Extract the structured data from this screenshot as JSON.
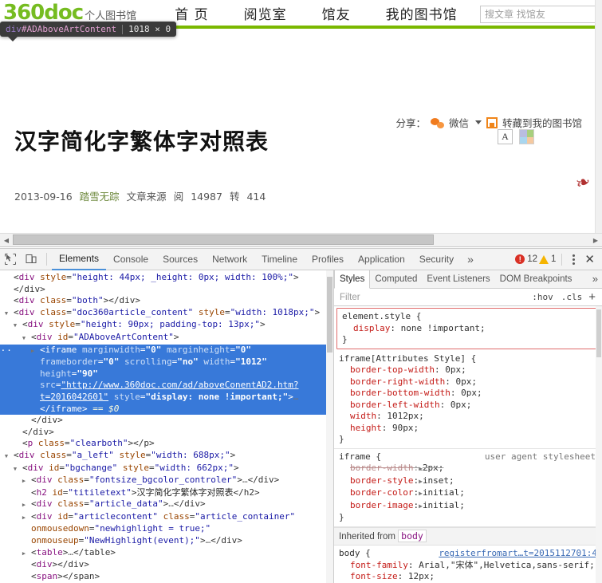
{
  "site": {
    "logo_main": "360doc",
    "logo_sub": "个人图书馆",
    "nav": [
      {
        "label": "首 页"
      },
      {
        "label": "阅览室"
      },
      {
        "label": "馆友"
      },
      {
        "label": "我的图书馆"
      }
    ],
    "search_placeholder": "搜文章 找馆友",
    "search_value": ""
  },
  "inspect_tooltip": {
    "tag": "div",
    "id": "#ADAboveArtContent",
    "dimensions": "1018 × 0"
  },
  "article": {
    "title": "汉字简化字繁体字对照表",
    "date": "2013-09-16",
    "author": "踏雪无踪",
    "source": "文章来源",
    "read_label": "阅",
    "read_count": "14987",
    "forward_label": "转",
    "forward_count": "414",
    "font_btn": "A",
    "share_label": "分享：",
    "wechat_label": "微信",
    "save_label": "转藏到我的图书馆"
  },
  "devtools": {
    "tabs": [
      {
        "label": "Elements",
        "active": true
      },
      {
        "label": "Console",
        "active": false
      },
      {
        "label": "Sources",
        "active": false
      },
      {
        "label": "Network",
        "active": false
      },
      {
        "label": "Timeline",
        "active": false
      },
      {
        "label": "Profiles",
        "active": false
      },
      {
        "label": "Application",
        "active": false
      },
      {
        "label": "Security",
        "active": false
      }
    ],
    "more": "»",
    "error_count": "12",
    "warning_count": "1",
    "close": "✕"
  },
  "dom": {
    "lines": [
      {
        "indent": 1,
        "twisty": "none",
        "parts": [
          {
            "t": "punc",
            "v": "<"
          },
          {
            "t": "tag",
            "v": "div"
          },
          {
            "t": "sp",
            "v": " "
          },
          {
            "t": "attr",
            "v": "style"
          },
          {
            "t": "punc",
            "v": "="
          },
          {
            "t": "val",
            "v": "\"height: 44px; _height: 0px; width: 100%;\""
          },
          {
            "t": "punc",
            "v": "></div>"
          }
        ]
      },
      {
        "indent": 1,
        "twisty": "none",
        "parts": [
          {
            "t": "punc",
            "v": "<"
          },
          {
            "t": "tag",
            "v": "div"
          },
          {
            "t": "sp",
            "v": " "
          },
          {
            "t": "attr",
            "v": "class"
          },
          {
            "t": "punc",
            "v": "="
          },
          {
            "t": "val",
            "v": "\"both\""
          },
          {
            "t": "punc",
            "v": "></div>"
          }
        ]
      },
      {
        "indent": 1,
        "twisty": "open",
        "parts": [
          {
            "t": "punc",
            "v": "<"
          },
          {
            "t": "tag",
            "v": "div"
          },
          {
            "t": "sp",
            "v": " "
          },
          {
            "t": "attr",
            "v": "class"
          },
          {
            "t": "punc",
            "v": "="
          },
          {
            "t": "val",
            "v": "\"doc360article_content\""
          },
          {
            "t": "sp",
            "v": " "
          },
          {
            "t": "attr",
            "v": "style"
          },
          {
            "t": "punc",
            "v": "="
          },
          {
            "t": "val",
            "v": "\"width: 1018px;\""
          },
          {
            "t": "punc",
            "v": ">"
          }
        ]
      },
      {
        "indent": 2,
        "twisty": "open",
        "parts": [
          {
            "t": "punc",
            "v": "<"
          },
          {
            "t": "tag",
            "v": "div"
          },
          {
            "t": "sp",
            "v": " "
          },
          {
            "t": "attr",
            "v": "style"
          },
          {
            "t": "punc",
            "v": "="
          },
          {
            "t": "val",
            "v": "\"height: 90px; padding-top: 13px;\""
          },
          {
            "t": "punc",
            "v": ">"
          }
        ]
      },
      {
        "indent": 3,
        "twisty": "open",
        "parts": [
          {
            "t": "punc",
            "v": "<"
          },
          {
            "t": "tag",
            "v": "div"
          },
          {
            "t": "sp",
            "v": " "
          },
          {
            "t": "attr",
            "v": "id"
          },
          {
            "t": "punc",
            "v": "="
          },
          {
            "t": "val",
            "v": "\"ADAboveArtContent\""
          },
          {
            "t": "punc",
            "v": ">"
          }
        ]
      },
      {
        "indent": 4,
        "twisty": "closed",
        "selected": true,
        "parts": [
          {
            "t": "punc",
            "v": "<"
          },
          {
            "t": "tag",
            "v": "iframe"
          },
          {
            "t": "sp",
            "v": " "
          },
          {
            "t": "attr",
            "v": "marginwidth"
          },
          {
            "t": "punc",
            "v": "="
          },
          {
            "t": "val",
            "v": "\"0\""
          },
          {
            "t": "sp",
            "v": " "
          },
          {
            "t": "attr",
            "v": "marginheight"
          },
          {
            "t": "punc",
            "v": "="
          },
          {
            "t": "val",
            "v": "\"0\""
          },
          {
            "t": "sp",
            "v": " "
          },
          {
            "t": "attr",
            "v": "frameborder"
          },
          {
            "t": "punc",
            "v": "="
          },
          {
            "t": "val",
            "v": "\"0\""
          },
          {
            "t": "sp",
            "v": " "
          },
          {
            "t": "attr",
            "v": "scrolling"
          },
          {
            "t": "punc",
            "v": "="
          },
          {
            "t": "val",
            "v": "\"no\""
          },
          {
            "t": "sp",
            "v": " "
          },
          {
            "t": "attr",
            "v": "width"
          },
          {
            "t": "punc",
            "v": "="
          },
          {
            "t": "val",
            "v": "\"1012\""
          },
          {
            "t": "sp",
            "v": " "
          },
          {
            "t": "attr",
            "v": "height"
          },
          {
            "t": "punc",
            "v": "="
          },
          {
            "t": "val",
            "v": "\"90\""
          },
          {
            "t": "sp",
            "v": " "
          },
          {
            "t": "attr",
            "v": "src"
          },
          {
            "t": "punc",
            "v": "="
          },
          {
            "t": "lnk",
            "v": "\"http://www.360doc.com/ad/aboveConentAD2.htm?t=2016042601\""
          },
          {
            "t": "sp",
            "v": " "
          },
          {
            "t": "attr",
            "v": "style"
          },
          {
            "t": "punc",
            "v": "="
          },
          {
            "t": "val",
            "v": "\"display: none !important;\""
          },
          {
            "t": "punc",
            "v": ">"
          },
          {
            "t": "ellip",
            "v": "…"
          },
          {
            "t": "punc",
            "v": "</iframe>"
          },
          {
            "t": "sp",
            "v": " "
          },
          {
            "t": "dollar",
            "v": "== $0"
          }
        ]
      },
      {
        "indent": 3,
        "twisty": "none",
        "parts": [
          {
            "t": "punc",
            "v": "</div>"
          }
        ]
      },
      {
        "indent": 2,
        "twisty": "none",
        "parts": [
          {
            "t": "punc",
            "v": "</div>"
          }
        ]
      },
      {
        "indent": 2,
        "twisty": "none",
        "parts": [
          {
            "t": "punc",
            "v": "<"
          },
          {
            "t": "tag",
            "v": "p"
          },
          {
            "t": "sp",
            "v": " "
          },
          {
            "t": "attr",
            "v": "class"
          },
          {
            "t": "punc",
            "v": "="
          },
          {
            "t": "val",
            "v": "\"clearboth\""
          },
          {
            "t": "punc",
            "v": "></p>"
          }
        ]
      },
      {
        "indent": 1,
        "twisty": "open",
        "parts": [
          {
            "t": "punc",
            "v": "<"
          },
          {
            "t": "tag",
            "v": "div"
          },
          {
            "t": "sp",
            "v": " "
          },
          {
            "t": "attr",
            "v": "class"
          },
          {
            "t": "punc",
            "v": "="
          },
          {
            "t": "val",
            "v": "\"a_left\""
          },
          {
            "t": "sp",
            "v": " "
          },
          {
            "t": "attr",
            "v": "style"
          },
          {
            "t": "punc",
            "v": "="
          },
          {
            "t": "val",
            "v": "\"width: 688px;\""
          },
          {
            "t": "punc",
            "v": ">"
          }
        ]
      },
      {
        "indent": 2,
        "twisty": "open",
        "parts": [
          {
            "t": "punc",
            "v": "<"
          },
          {
            "t": "tag",
            "v": "div"
          },
          {
            "t": "sp",
            "v": " "
          },
          {
            "t": "attr",
            "v": "id"
          },
          {
            "t": "punc",
            "v": "="
          },
          {
            "t": "val",
            "v": "\"bgchange\""
          },
          {
            "t": "sp",
            "v": " "
          },
          {
            "t": "attr",
            "v": "style"
          },
          {
            "t": "punc",
            "v": "="
          },
          {
            "t": "val",
            "v": "\"width: 662px;\""
          },
          {
            "t": "punc",
            "v": ">"
          }
        ]
      },
      {
        "indent": 3,
        "twisty": "closed",
        "parts": [
          {
            "t": "punc",
            "v": "<"
          },
          {
            "t": "tag",
            "v": "div"
          },
          {
            "t": "sp",
            "v": " "
          },
          {
            "t": "attr",
            "v": "class"
          },
          {
            "t": "punc",
            "v": "="
          },
          {
            "t": "val",
            "v": "\"fontsize_bgcolor_controler\""
          },
          {
            "t": "punc",
            "v": ">"
          },
          {
            "t": "ellip",
            "v": "…"
          },
          {
            "t": "punc",
            "v": "</div>"
          }
        ]
      },
      {
        "indent": 3,
        "twisty": "none",
        "parts": [
          {
            "t": "punc",
            "v": "<"
          },
          {
            "t": "tag",
            "v": "h2"
          },
          {
            "t": "sp",
            "v": " "
          },
          {
            "t": "attr",
            "v": "id"
          },
          {
            "t": "punc",
            "v": "="
          },
          {
            "t": "val",
            "v": "\"titiletext\""
          },
          {
            "t": "punc",
            "v": ">"
          },
          {
            "t": "txt",
            "v": "汉字简化字繁体字对照表"
          },
          {
            "t": "punc",
            "v": "</h2>"
          }
        ]
      },
      {
        "indent": 3,
        "twisty": "closed",
        "parts": [
          {
            "t": "punc",
            "v": "<"
          },
          {
            "t": "tag",
            "v": "div"
          },
          {
            "t": "sp",
            "v": " "
          },
          {
            "t": "attr",
            "v": "class"
          },
          {
            "t": "punc",
            "v": "="
          },
          {
            "t": "val",
            "v": "\"article_data\""
          },
          {
            "t": "punc",
            "v": ">"
          },
          {
            "t": "ellip",
            "v": "…"
          },
          {
            "t": "punc",
            "v": "</div>"
          }
        ]
      },
      {
        "indent": 3,
        "twisty": "closed",
        "parts": [
          {
            "t": "punc",
            "v": "<"
          },
          {
            "t": "tag",
            "v": "div"
          },
          {
            "t": "sp",
            "v": " "
          },
          {
            "t": "attr",
            "v": "id"
          },
          {
            "t": "punc",
            "v": "="
          },
          {
            "t": "val",
            "v": "\"articlecontent\""
          },
          {
            "t": "sp",
            "v": " "
          },
          {
            "t": "attr",
            "v": "class"
          },
          {
            "t": "punc",
            "v": "="
          },
          {
            "t": "val",
            "v": "\"article_container\""
          },
          {
            "t": "sp",
            "v": " "
          },
          {
            "t": "attr",
            "v": "onmousedown"
          },
          {
            "t": "punc",
            "v": "="
          },
          {
            "t": "val",
            "v": "\"newhighlight = true;\""
          },
          {
            "t": "sp",
            "v": " "
          },
          {
            "t": "attr",
            "v": "onmouseup"
          },
          {
            "t": "punc",
            "v": "="
          },
          {
            "t": "val",
            "v": "\"NewHighlight(event);\""
          },
          {
            "t": "punc",
            "v": ">"
          },
          {
            "t": "ellip",
            "v": "…"
          },
          {
            "t": "punc",
            "v": "</div>"
          }
        ]
      },
      {
        "indent": 3,
        "twisty": "closed",
        "parts": [
          {
            "t": "punc",
            "v": "<"
          },
          {
            "t": "tag",
            "v": "table"
          },
          {
            "t": "punc",
            "v": ">"
          },
          {
            "t": "ellip",
            "v": "…"
          },
          {
            "t": "punc",
            "v": "</table>"
          }
        ]
      },
      {
        "indent": 3,
        "twisty": "none",
        "parts": [
          {
            "t": "punc",
            "v": "<"
          },
          {
            "t": "tag",
            "v": "div"
          },
          {
            "t": "punc",
            "v": "></div>"
          }
        ]
      },
      {
        "indent": 3,
        "twisty": "none",
        "parts": [
          {
            "t": "punc",
            "v": "<"
          },
          {
            "t": "tag",
            "v": "span"
          },
          {
            "t": "punc",
            "v": "></span>"
          }
        ]
      }
    ]
  },
  "styles_panel": {
    "tabs": [
      {
        "label": "Styles",
        "active": true
      },
      {
        "label": "Computed",
        "active": false
      },
      {
        "label": "Event Listeners",
        "active": false
      },
      {
        "label": "DOM Breakpoints",
        "active": false
      }
    ],
    "more": "»",
    "filter_placeholder": "Filter",
    "filter_value": "",
    "hov": ":hov",
    "cls": ".cls",
    "plus": "+",
    "rules": [
      {
        "selector": "element.style {",
        "boxed": true,
        "close": "}",
        "declarations": [
          {
            "prop": "display",
            "value": "none !important;",
            "strike": false
          }
        ]
      },
      {
        "selector": "iframe[Attributes Style] {",
        "boxed": false,
        "close": "}",
        "declarations": [
          {
            "prop": "border-top-width",
            "value": "0px;",
            "strike": false
          },
          {
            "prop": "border-right-width",
            "value": "0px;",
            "strike": false
          },
          {
            "prop": "border-bottom-width",
            "value": "0px;",
            "strike": false
          },
          {
            "prop": "border-left-width",
            "value": "0px;",
            "strike": false
          },
          {
            "prop": "width",
            "value": "1012px;",
            "strike": false
          },
          {
            "prop": "height",
            "value": "90px;",
            "strike": false
          }
        ]
      },
      {
        "selector": "iframe {",
        "note": "user agent stylesheet",
        "boxed": false,
        "close": "}",
        "declarations": [
          {
            "prop": "border-width",
            "value": "2px;",
            "strike": true,
            "disc": true
          },
          {
            "prop": "border-style",
            "value": "inset;",
            "strike": false,
            "disc": true
          },
          {
            "prop": "border-color",
            "value": "initial;",
            "strike": false,
            "disc": true
          },
          {
            "prop": "border-image",
            "value": "initial;",
            "strike": false,
            "disc": true
          }
        ]
      }
    ],
    "inherited_label": "Inherited from",
    "inherited_chip": "body",
    "body_rule": {
      "selector": "body {",
      "source": "registerfromart…t=2015112701:4",
      "declarations": [
        {
          "prop": "font-family",
          "value": "Arial,\"宋体\",Helvetica,sans-serif;"
        },
        {
          "prop": "font-size",
          "value": "12px;"
        }
      ]
    }
  }
}
